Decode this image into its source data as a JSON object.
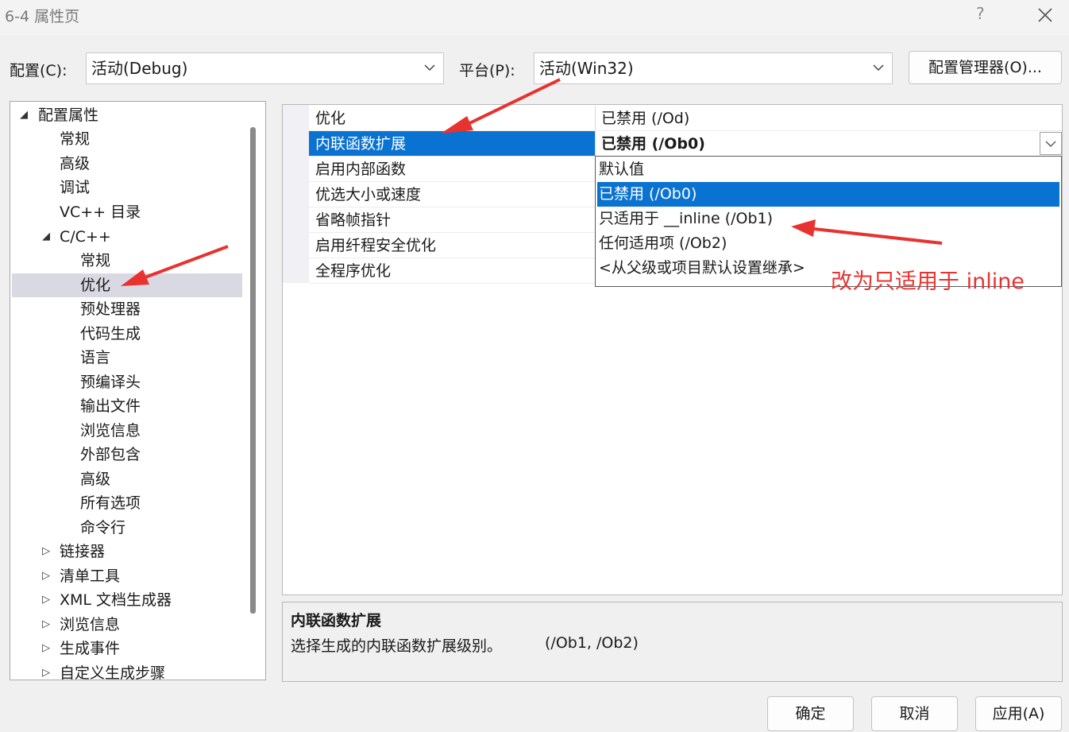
{
  "window": {
    "title": "6-4 属性页",
    "help_label": "?",
    "close_icon": "close-icon"
  },
  "config_row": {
    "config_label": "配置(C):",
    "config_value": "活动(Debug)",
    "platform_label": "平台(P):",
    "platform_value": "活动(Win32)",
    "manager_button": "配置管理器(O)..."
  },
  "tree": {
    "root": "配置属性",
    "items": [
      "常规",
      "高级",
      "调试",
      "VC++ 目录",
      "C/C++",
      "常规",
      "优化",
      "预处理器",
      "代码生成",
      "语言",
      "预编译头",
      "输出文件",
      "浏览信息",
      "外部包含",
      "高级",
      "所有选项",
      "命令行",
      "链接器",
      "清单工具",
      "XML 文档生成器",
      "浏览信息",
      "生成事件",
      "自定义生成步骤"
    ],
    "selected": "优化"
  },
  "grid": {
    "rows": [
      {
        "name": "优化",
        "value": "已禁用 (/Od)"
      },
      {
        "name": "内联函数扩展",
        "value": "已禁用 (/Ob0)"
      },
      {
        "name": "启用内部函数",
        "value": ""
      },
      {
        "name": "优选大小或速度",
        "value": ""
      },
      {
        "name": "省略帧指针",
        "value": ""
      },
      {
        "name": "启用纤程安全优化",
        "value": ""
      },
      {
        "name": "全程序优化",
        "value": ""
      }
    ],
    "selected_row": 1
  },
  "dropdown": {
    "options": [
      "默认值",
      "已禁用 (/Ob0)",
      "只适用于 __inline (/Ob1)",
      "任何适用项 (/Ob2)",
      "<从父级或项目默认设置继承>"
    ],
    "highlighted": 1
  },
  "annotation": {
    "text": "改为只适用于 inline",
    "color": "#e8322f"
  },
  "description": {
    "title": "内联函数扩展",
    "text": "选择生成的内联函数扩展级别。",
    "flags": "(/Ob1, /Ob2)"
  },
  "buttons": {
    "ok": "确定",
    "cancel": "取消",
    "apply": "应用(A)"
  },
  "colors": {
    "selection": "#0a72d1",
    "annotation_red": "#e8322f"
  }
}
